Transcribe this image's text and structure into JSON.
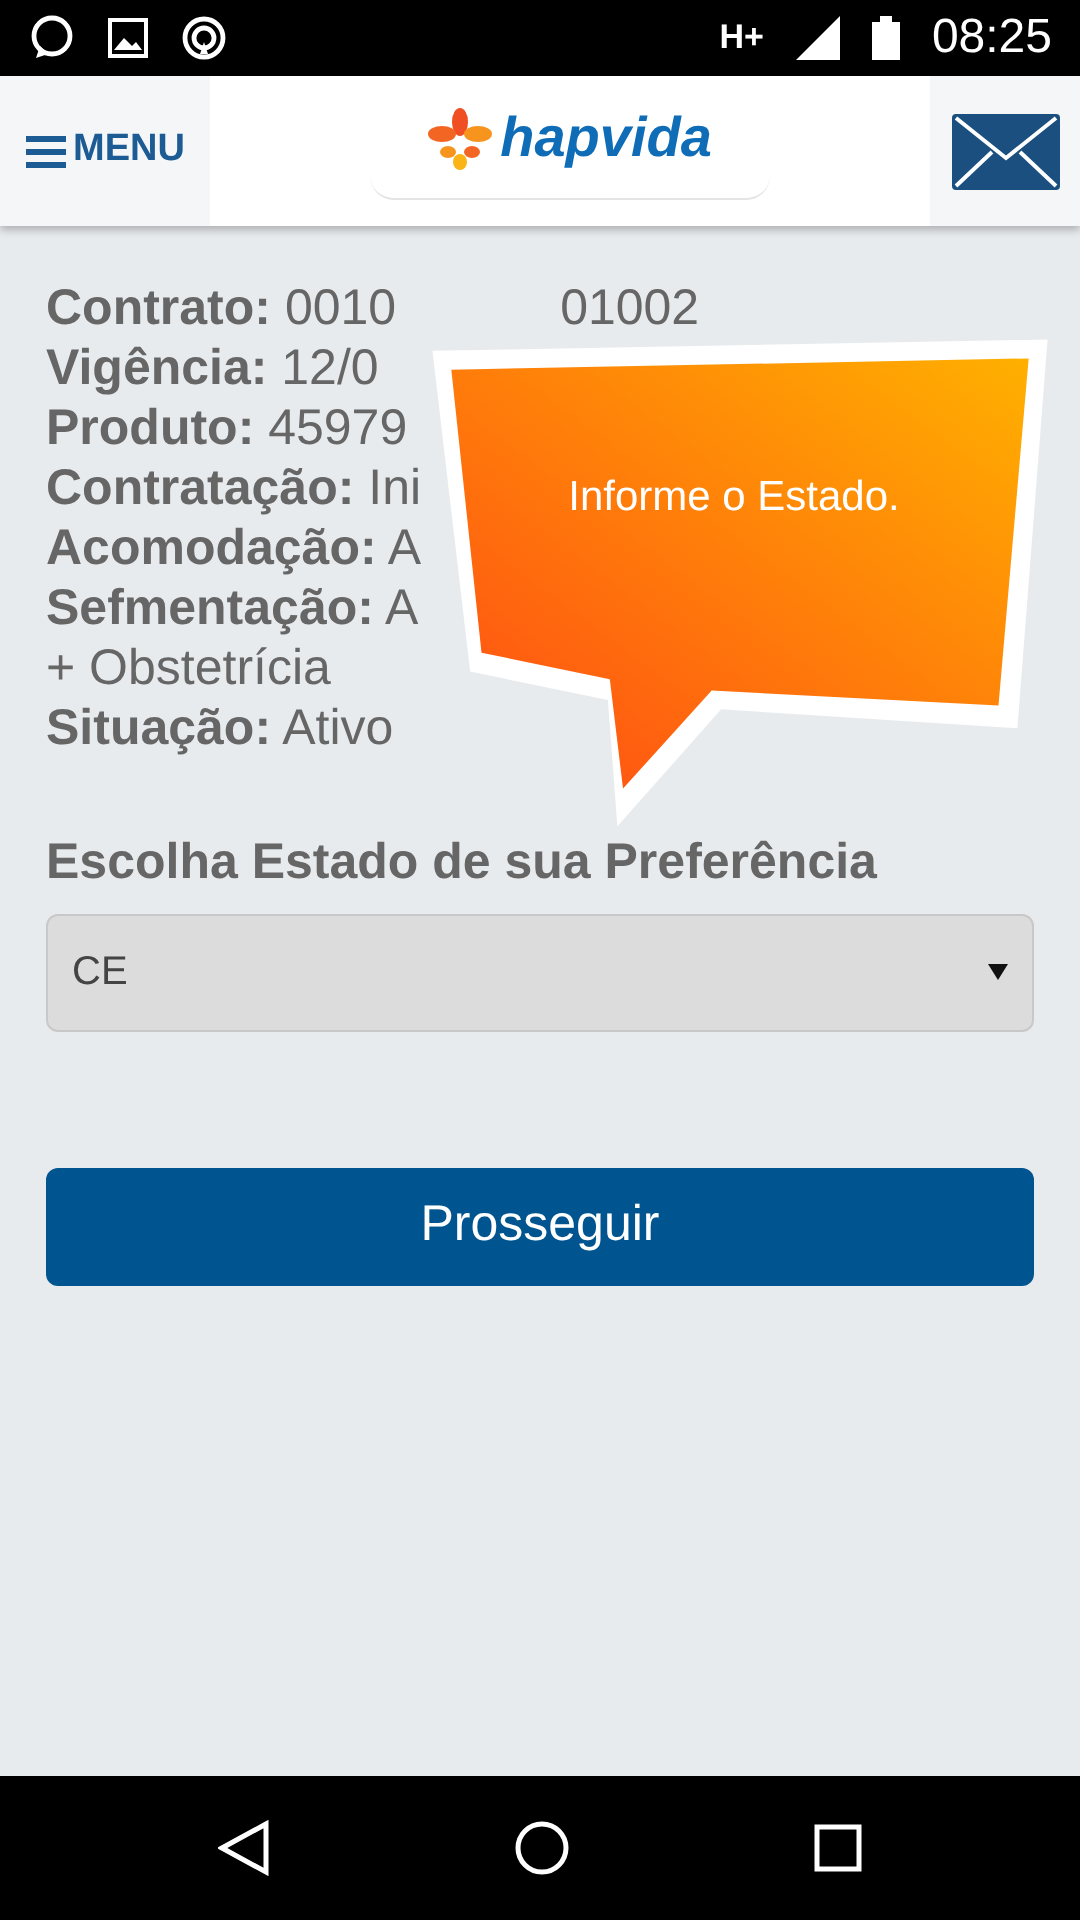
{
  "status_bar": {
    "network": "H+",
    "time": "08:25"
  },
  "header": {
    "menu_label": "MENU",
    "logo_text": "hapvida"
  },
  "details": [
    {
      "label": "Contrato:",
      "value": "0010",
      "value_end": "01002"
    },
    {
      "label": "Vigência:",
      "value": "12/0"
    },
    {
      "label": "Produto:",
      "value": "45979"
    },
    {
      "label": "Contratação:",
      "value": "Ini"
    },
    {
      "label": "Acomodação:",
      "value": "A"
    },
    {
      "label": "Sefmentação:",
      "value": "A"
    },
    {
      "value": "+ Obstetrícia"
    },
    {
      "label": "Situação:",
      "value": "Ativo"
    }
  ],
  "state_select": {
    "label": "Escolha Estado de sua Preferência",
    "value": "CE"
  },
  "continue_button": "Prosseguir",
  "tooltip": "Informe o Estado."
}
